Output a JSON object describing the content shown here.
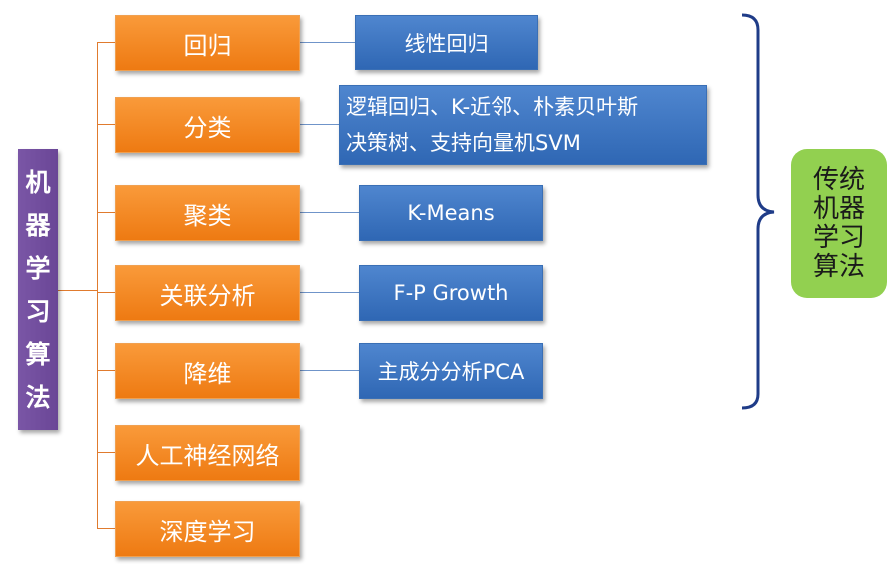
{
  "root": {
    "label_chars": [
      "机",
      "器",
      "学",
      "习",
      "算",
      "法"
    ]
  },
  "categories": [
    {
      "label": "回归"
    },
    {
      "label": "分类"
    },
    {
      "label": "聚类"
    },
    {
      "label": "关联分析"
    },
    {
      "label": "降维"
    },
    {
      "label": "人工神经网络"
    },
    {
      "label": "深度学习"
    }
  ],
  "algorithms": [
    {
      "lines": [
        "线性回归"
      ]
    },
    {
      "lines": [
        "逻辑回归、K-近邻、朴素贝叶斯",
        "决策树、支持向量机SVM"
      ]
    },
    {
      "lines": [
        "K-Means"
      ]
    },
    {
      "lines": [
        "F-P Growth"
      ]
    },
    {
      "lines": [
        "主成分分析PCA"
      ]
    }
  ],
  "traditional": {
    "label_lines": [
      "传统",
      "机器",
      "学习",
      "算法"
    ]
  },
  "colors": {
    "root": "#7030a0",
    "category": "#f58220",
    "algorithm": "#3a70bd",
    "traditional": "#92d050",
    "brace": "#1f3c88"
  }
}
